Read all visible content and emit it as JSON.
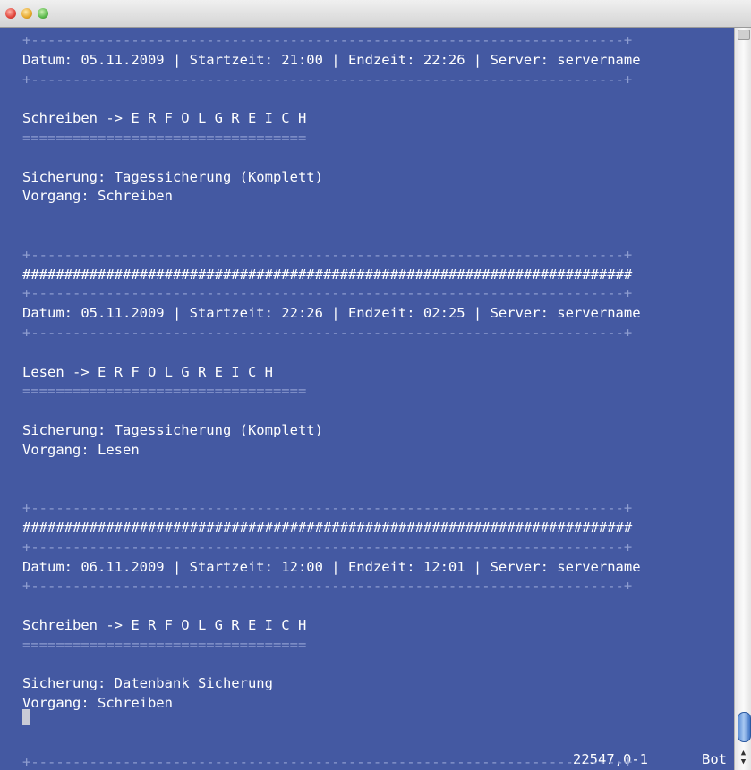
{
  "window": {
    "controls": [
      "close",
      "minimize",
      "zoom"
    ]
  },
  "terminal": {
    "lines": [
      "+-----------------------------------------------------------------------+",
      "Datum: 05.11.2009 | Startzeit: 21:00 | Endzeit: 22:26 | Server: servername",
      "+-----------------------------------------------------------------------+",
      "",
      "Schreiben -> E R F O L G R E I C H",
      "==================================",
      "",
      "Sicherung: Tagessicherung (Komplett)",
      "Vorgang: Schreiben",
      "",
      "",
      "+-----------------------------------------------------------------------+",
      "#########################################################################",
      "+-----------------------------------------------------------------------+",
      "Datum: 05.11.2009 | Startzeit: 22:26 | Endzeit: 02:25 | Server: servername",
      "+-----------------------------------------------------------------------+",
      "",
      "Lesen -> E R F O L G R E I C H",
      "==================================",
      "",
      "Sicherung: Tagessicherung (Komplett)",
      "Vorgang: Lesen",
      "",
      "",
      "+-----------------------------------------------------------------------+",
      "#########################################################################",
      "+-----------------------------------------------------------------------+",
      "Datum: 06.11.2009 | Startzeit: 12:00 | Endzeit: 12:01 | Server: servername",
      "+-----------------------------------------------------------------------+",
      "",
      "Schreiben -> E R F O L G R E I C H",
      "==================================",
      "",
      "Sicherung: Datenbank Sicherung",
      "Vorgang: Schreiben",
      "",
      "",
      "+-----------------------------------------------------------------------+"
    ],
    "status": {
      "position": "22547,0-1",
      "scroll": "Bot"
    }
  },
  "colors": {
    "background": "#4459a2",
    "text": "#ffffff",
    "rule": "#8e9dd0"
  }
}
